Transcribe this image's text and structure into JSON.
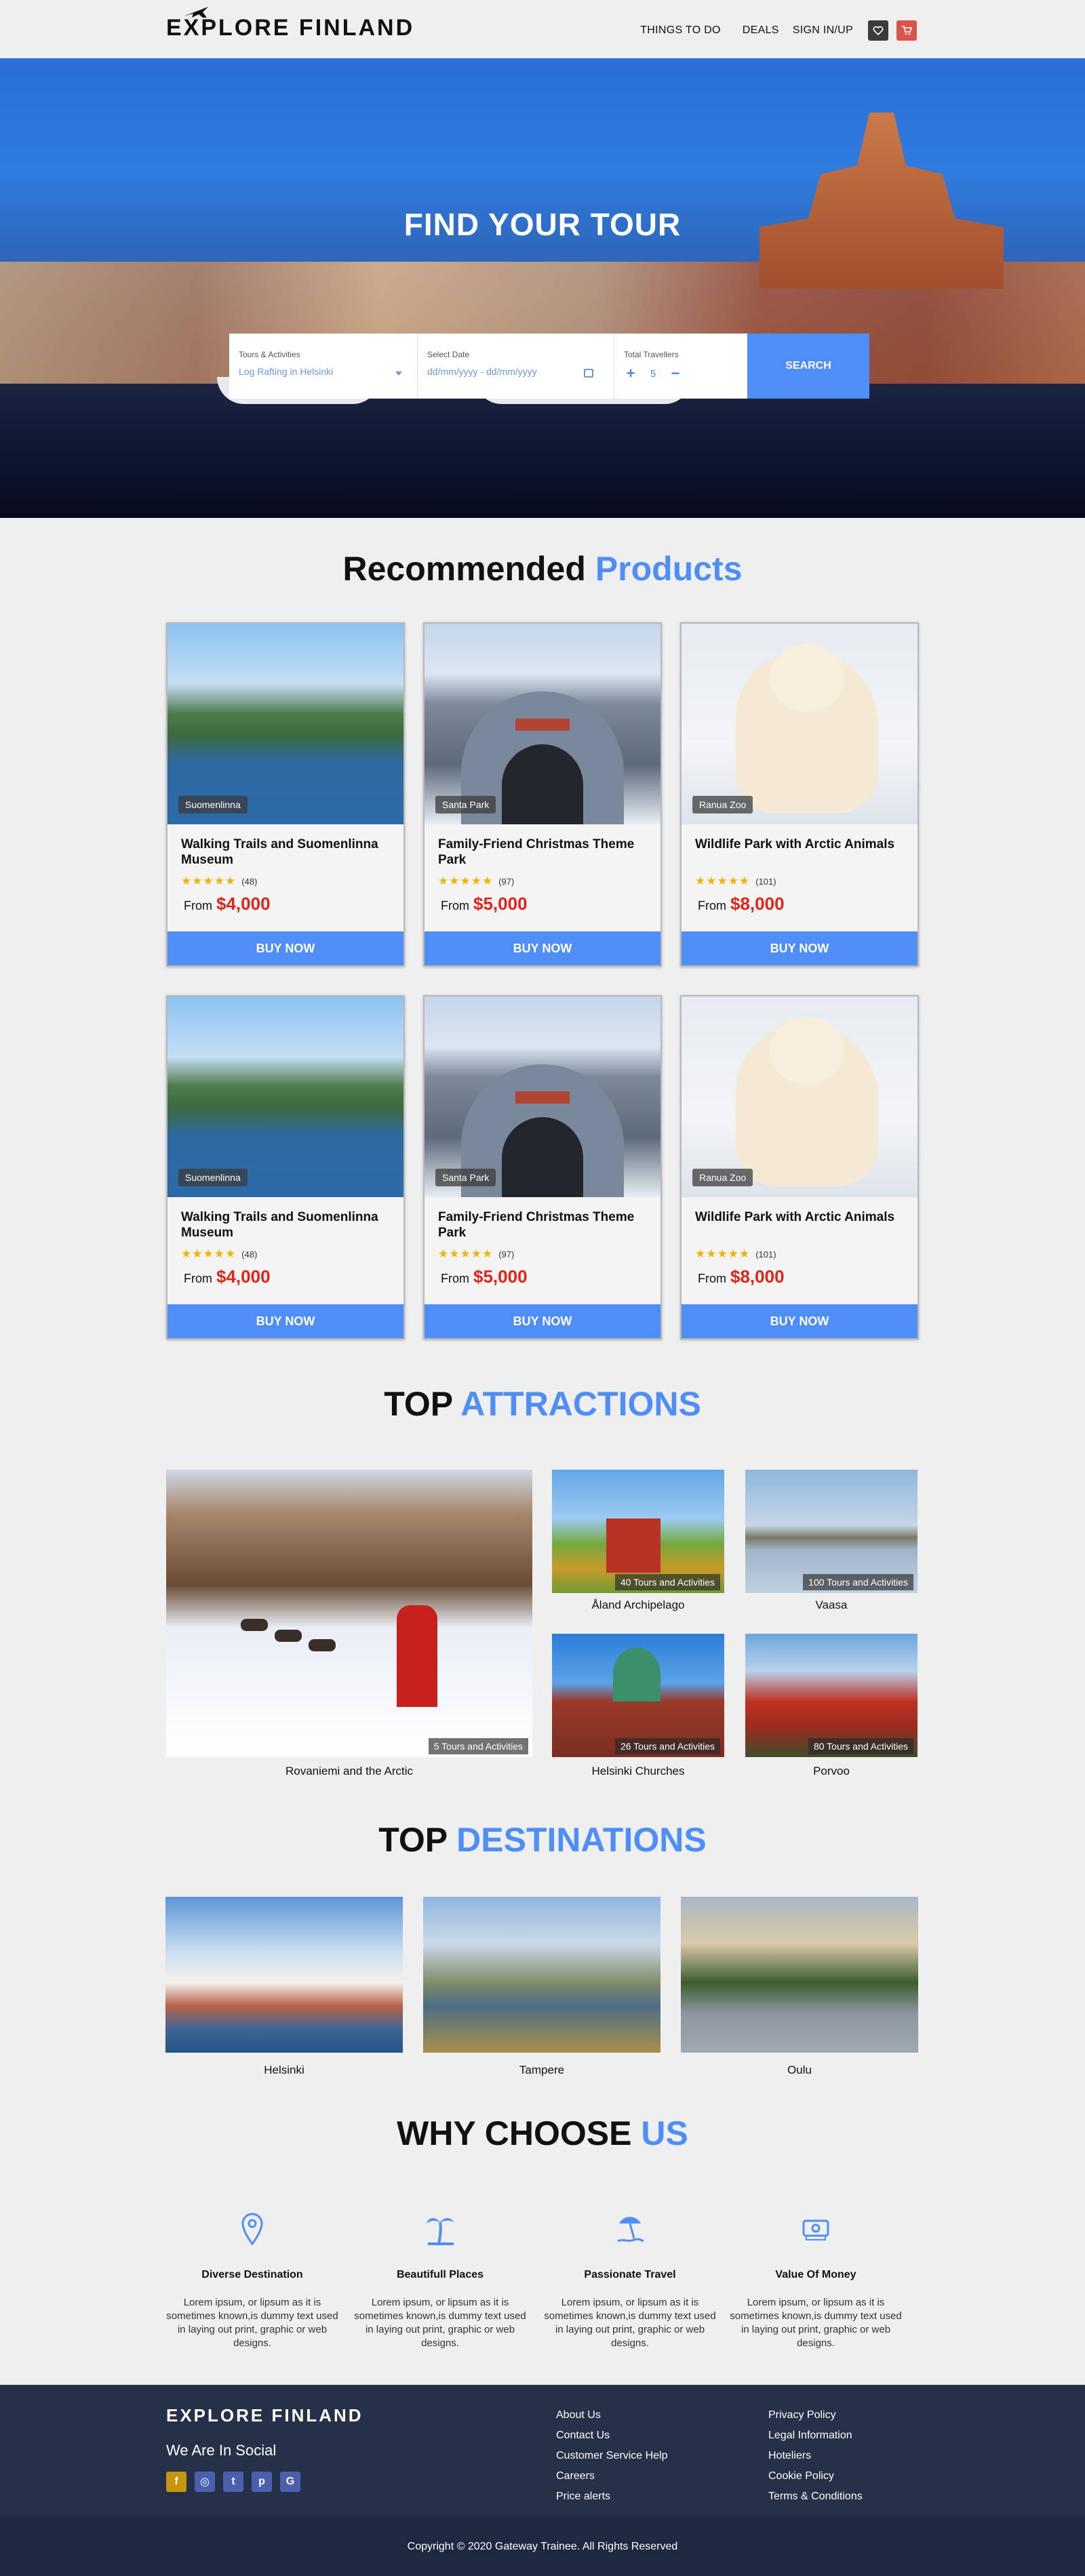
{
  "nav": {
    "logo": "EXPLORE FINLAND",
    "links": [
      "THINGS TO DO",
      "DEALS",
      "SIGN IN/UP"
    ]
  },
  "hero": {
    "title": "FIND YOUR TOUR",
    "tours_label": "Tours & Activities",
    "tours_value": "Log Rafting in Helsinki",
    "date_label": "Select Date",
    "date_value": "dd/mm/yyyy - dd/mm/yyyy",
    "travellers_label": "Total Travellers",
    "travellers_value": "5",
    "search_button": "SEARCH"
  },
  "recommended": {
    "title_main": "Recommended",
    "title_accent": "Products",
    "products": [
      {
        "tag": "Suomenlinna",
        "title": "Walking Trails and Suomenlinna Museum",
        "stars": "★★★★★",
        "count": "(48)",
        "from": "From",
        "price": "$4,000",
        "button": "BUY NOW"
      },
      {
        "tag": "Santa Park",
        "title": "Family-Friend Christmas Theme Park",
        "stars": "★★★★★",
        "count": "(97)",
        "from": "From",
        "price": "$5,000",
        "button": "BUY NOW"
      },
      {
        "tag": "Ranua Zoo",
        "title": "Wildlife Park with Arctic Animals",
        "stars": "★★★★★",
        "count": "(101)",
        "from": "From",
        "price": "$8,000",
        "button": "BUY NOW"
      },
      {
        "tag": "Suomenlinna",
        "title": "Walking Trails and Suomenlinna Museum",
        "stars": "★★★★★",
        "count": "(48)",
        "from": "From",
        "price": "$4,000",
        "button": "BUY NOW"
      },
      {
        "tag": "Santa Park",
        "title": "Family-Friend Christmas Theme Park",
        "stars": "★★★★★",
        "count": "(97)",
        "from": "From",
        "price": "$5,000",
        "button": "BUY NOW"
      },
      {
        "tag": "Ranua Zoo",
        "title": "Wildlife Park with Arctic Animals",
        "stars": "★★★★★",
        "count": "(101)",
        "from": "From",
        "price": "$8,000",
        "button": "BUY NOW"
      }
    ]
  },
  "attractions": {
    "title_main": "TOP",
    "title_accent": "ATTRACTIONS",
    "items": [
      {
        "name": "Rovaniemi and the Arctic",
        "badge": "5 Tours and Activities"
      },
      {
        "name": "Åland Archipelago",
        "badge": "40 Tours and Activities"
      },
      {
        "name": "Vaasa",
        "badge": "100 Tours and Activities"
      },
      {
        "name": "Helsinki Churches",
        "badge": "26 Tours and Activities"
      },
      {
        "name": "Porvoo",
        "badge": "80 Tours and Activities"
      }
    ]
  },
  "destinations": {
    "title_main": "TOP",
    "title_accent": "DESTINATIONS",
    "items": [
      "Helsinki",
      "Tampere",
      "Oulu"
    ]
  },
  "why": {
    "title_main": "WHY CHOOSE",
    "title_accent": "US",
    "items": [
      {
        "title": "Diverse Destination",
        "text": "Lorem ipsum, or lipsum as it is sometimes known,is dummy text used in laying out print, graphic or web designs."
      },
      {
        "title": "Beautifull Places",
        "text": "Lorem ipsum, or lipsum as it is sometimes known,is dummy text used in laying out print, graphic or web designs."
      },
      {
        "title": "Passionate Travel",
        "text": "Lorem ipsum, or lipsum as it is sometimes known,is dummy text used in laying out print, graphic or web designs."
      },
      {
        "title": "Value Of Money",
        "text": "Lorem ipsum, or lipsum as it is sometimes known,is dummy text used in laying out print, graphic or web designs."
      }
    ]
  },
  "footer": {
    "logo": "EXPLORE FINLAND",
    "social_title": "We Are In Social",
    "col1": [
      "About Us",
      "Contact Us",
      "Customer Service Help",
      "Careers",
      "Price alerts"
    ],
    "col2": [
      "Privacy Policy",
      "Legal Information",
      "Hoteliers",
      "Cookie Policy",
      "Terms & Conditions"
    ],
    "copyright": "Copyright © 2020 Gateway Trainee. All Rights Reserved"
  },
  "colors": {
    "accent": "#4f8ef7",
    "price": "#e2231a",
    "footer": "#243149"
  }
}
